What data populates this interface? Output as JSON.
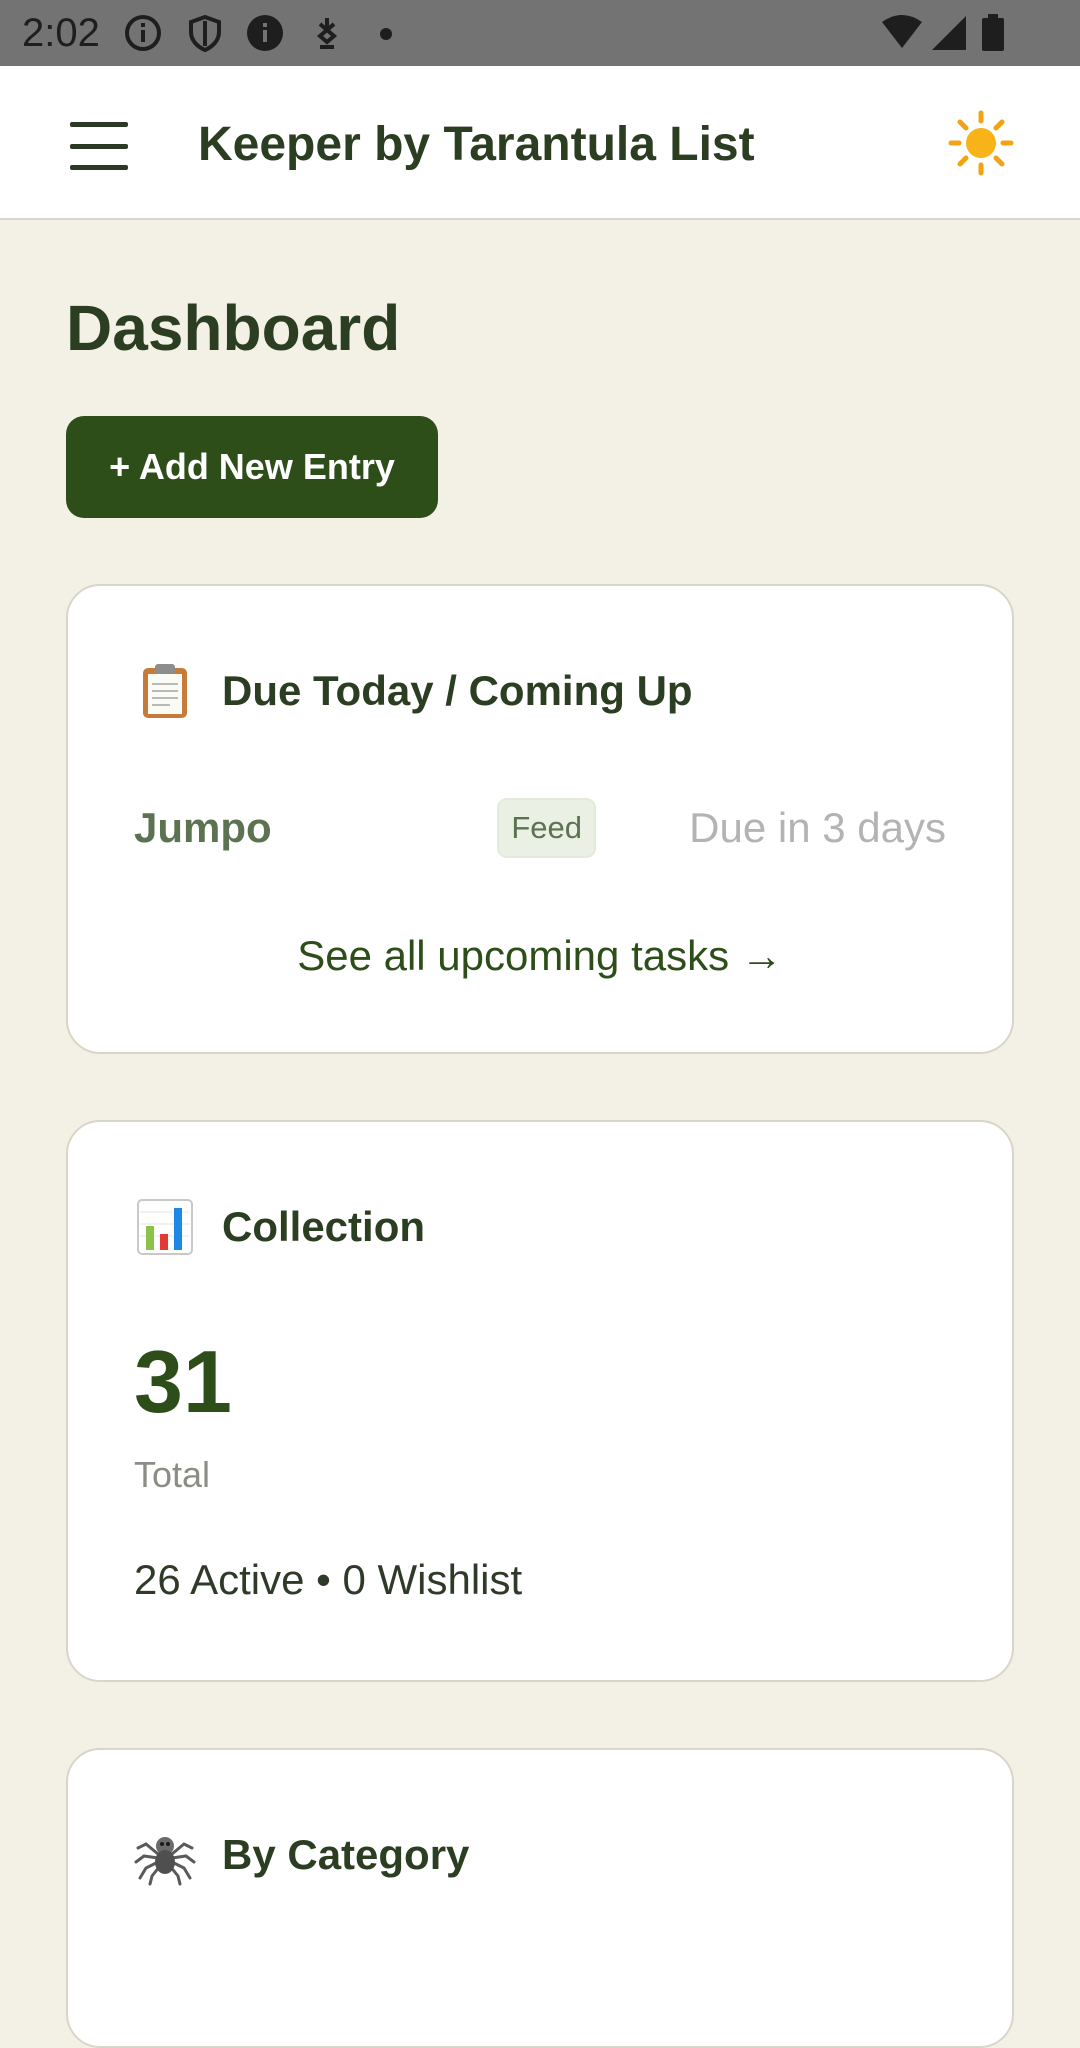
{
  "status_bar": {
    "time": "2:02",
    "icons": [
      "info-circle-icon",
      "shield-icon",
      "info-filled-icon",
      "download-icon",
      "notification-dot-icon",
      "wifi-icon",
      "cell-signal-icon",
      "battery-icon"
    ],
    "background": "#737373"
  },
  "app_bar": {
    "title": "Keeper by Tarantula List",
    "menu_icon": "hamburger-menu-icon",
    "theme_icon": "sun-icon"
  },
  "page": {
    "title": "Dashboard",
    "add_button_label": "+ Add New Entry"
  },
  "due_card": {
    "icon": "clipboard-icon",
    "title": "Due Today / Coming Up",
    "tasks": [
      {
        "name": "Jumpo",
        "badge": "Feed",
        "due": "Due in 3 days"
      }
    ],
    "see_all_label": "See all upcoming tasks →"
  },
  "collection_card": {
    "icon": "bar-chart-icon",
    "title": "Collection",
    "total": "31",
    "total_label": "Total",
    "summary": "26 Active • 0 Wishlist"
  },
  "category_card": {
    "icon": "spider-icon",
    "title": "By Category"
  },
  "colors": {
    "page_background": "#f3f1e6",
    "primary": "#2e4e19",
    "title_text": "#2c3e22",
    "card_border": "#d9d6c9",
    "muted_text": "#b3b3b3"
  }
}
